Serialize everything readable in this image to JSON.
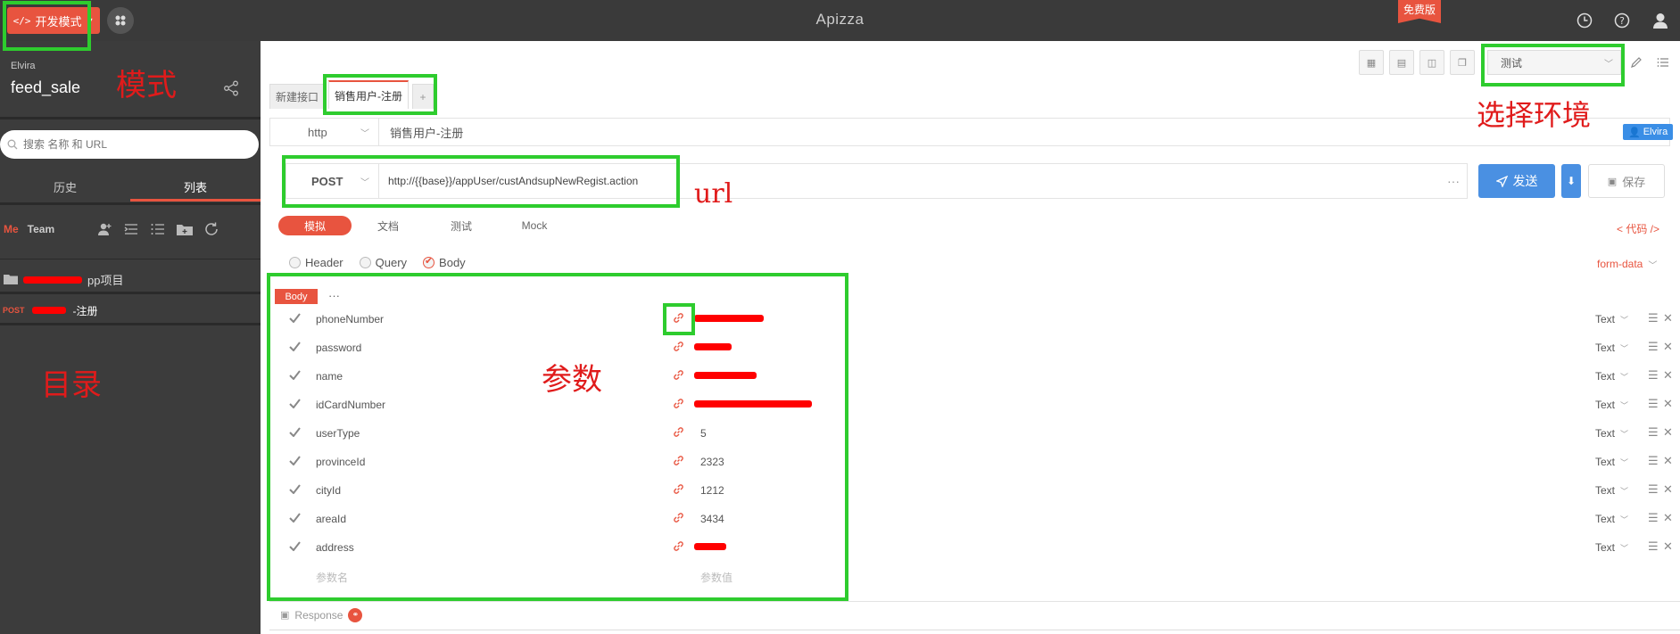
{
  "topbar": {
    "mode_label": "开发模式",
    "app_title": "Apizza",
    "free_badge": "免费版"
  },
  "sidebar": {
    "user": "Elvira",
    "project": "feed_sale",
    "search_placeholder": "搜索 名称 和 URL",
    "tabs": [
      "历史",
      "列表"
    ],
    "me_label": "Me",
    "team_label": "Team",
    "folder_name": "pp项目",
    "request_method": "POST",
    "request_name": "-注册"
  },
  "tabs": {
    "items": [
      "新建接口",
      "销售用户-注册"
    ],
    "add": "+"
  },
  "env": {
    "selected": "测试"
  },
  "request": {
    "protocol": "http",
    "name": "销售用户-注册",
    "user_chip": "Elvira",
    "method": "POST",
    "url": "http://{{base}}/appUser/custAndsupNewRegist.action",
    "url_more": "···",
    "send_label": "发送",
    "save_label": "保存"
  },
  "mode_tabs": [
    "模拟",
    "文档",
    "测试",
    "Mock"
  ],
  "code_link": "< 代码 />",
  "body_types": [
    "Header",
    "Query",
    "Body"
  ],
  "body_format": "form-data",
  "body_label": "Body",
  "body_more": "···",
  "params": [
    {
      "name": "phoneNumber",
      "value": "",
      "type": "Text"
    },
    {
      "name": "password",
      "value": "",
      "type": "Text"
    },
    {
      "name": "name",
      "value": "",
      "type": "Text"
    },
    {
      "name": "idCardNumber",
      "value": "",
      "type": "Text"
    },
    {
      "name": "userType",
      "value": "5",
      "type": "Text"
    },
    {
      "name": "provinceId",
      "value": "2323",
      "type": "Text"
    },
    {
      "name": "cityId",
      "value": "1212",
      "type": "Text"
    },
    {
      "name": "areaId",
      "value": "3434",
      "type": "Text"
    },
    {
      "name": "address",
      "value": "",
      "type": "Text"
    }
  ],
  "param_placeholder": {
    "name": "参数名",
    "value": "参数值"
  },
  "response_label": "Response",
  "annotations": {
    "mode": "模式",
    "env": "选择环境",
    "url": "url",
    "params": "参数",
    "catalog": "目录"
  },
  "colors": {
    "accent": "#e8543f",
    "primary": "#4a90e2",
    "annotation_box": "#2ecc2e",
    "annotation_text": "#e01b1b",
    "redaction": "#ff0000"
  }
}
